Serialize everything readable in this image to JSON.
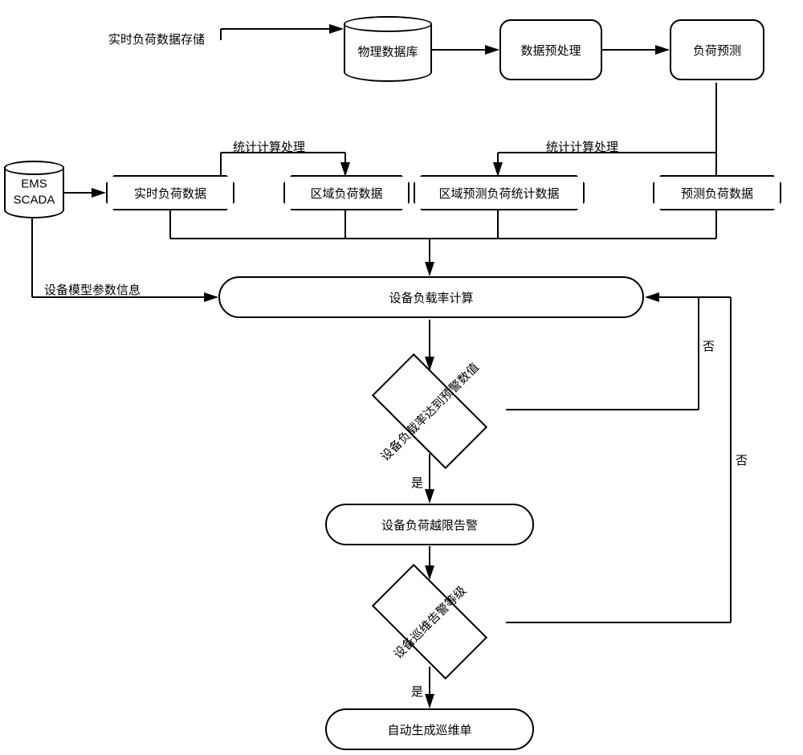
{
  "nodes": {
    "ems_scada": "EMS\nSCADA",
    "physical_db": "物理数据库",
    "data_preprocess": "数据预处理",
    "load_forecast": "负荷预测",
    "realtime_load_data": "实时负荷数据",
    "region_load_data": "区域负荷数据",
    "region_forecast_load_stats": "区域预测负荷统计数据",
    "forecast_load_data": "预测负荷数据",
    "device_load_rate_calc": "设备负载率计算",
    "device_rate_threshold": "设备负载率达到预警数值",
    "device_overlimit_alarm": "设备负荷越限告警",
    "device_patrol_alarm_level": "设备巡维告警等级",
    "auto_gen_patrol_order": "自动生成巡维单"
  },
  "edge_labels": {
    "realtime_store": "实时负荷数据存储",
    "stat_calc_left": "统计计算处理",
    "stat_calc_right": "统计计算处理",
    "device_model_params": "设备模型参数信息",
    "yes1": "是",
    "no1": "否",
    "yes2": "是",
    "no2": "否"
  }
}
